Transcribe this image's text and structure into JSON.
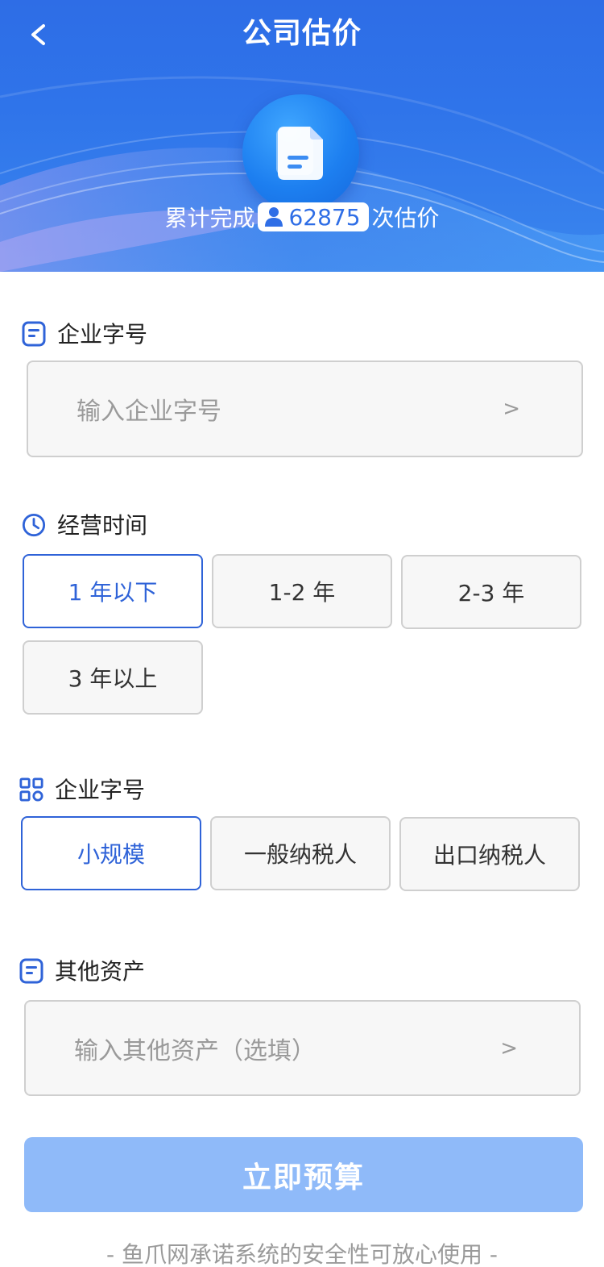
{
  "header": {
    "back_label": "<",
    "title": "公司估价",
    "stat_prefix": "累计完成",
    "stat_count": "62875",
    "stat_suffix": "次估价"
  },
  "sections": {
    "company_name": {
      "label": "企业字号",
      "placeholder": "输入企业字号",
      "chevron": ">"
    },
    "operating_time": {
      "label": "经营时间",
      "options": [
        "1 年以下",
        "1-2 年",
        "2-3 年",
        "3 年以上"
      ],
      "selected": "1 年以下"
    },
    "taxpayer_type": {
      "label": "企业字号",
      "options": [
        "小规模",
        "一般纳税人",
        "出口纳税人"
      ],
      "selected": "小规模"
    },
    "other_assets": {
      "label": "其他资产",
      "placeholder": "输入其他资产（选填）",
      "chevron": ">"
    }
  },
  "submit_label": "立即预算",
  "footer_note": "- 鱼爪网承诺系统的安全性可放心使用 -",
  "colors": {
    "primary": "#2f63d8",
    "banner": "#2f74ea",
    "submit_disabled": "#8fbaf9",
    "placeholder": "#9a9a9a"
  },
  "icons": [
    "back-icon",
    "document-icon",
    "user-icon",
    "form-icon",
    "clock-icon",
    "grid-icon"
  ]
}
